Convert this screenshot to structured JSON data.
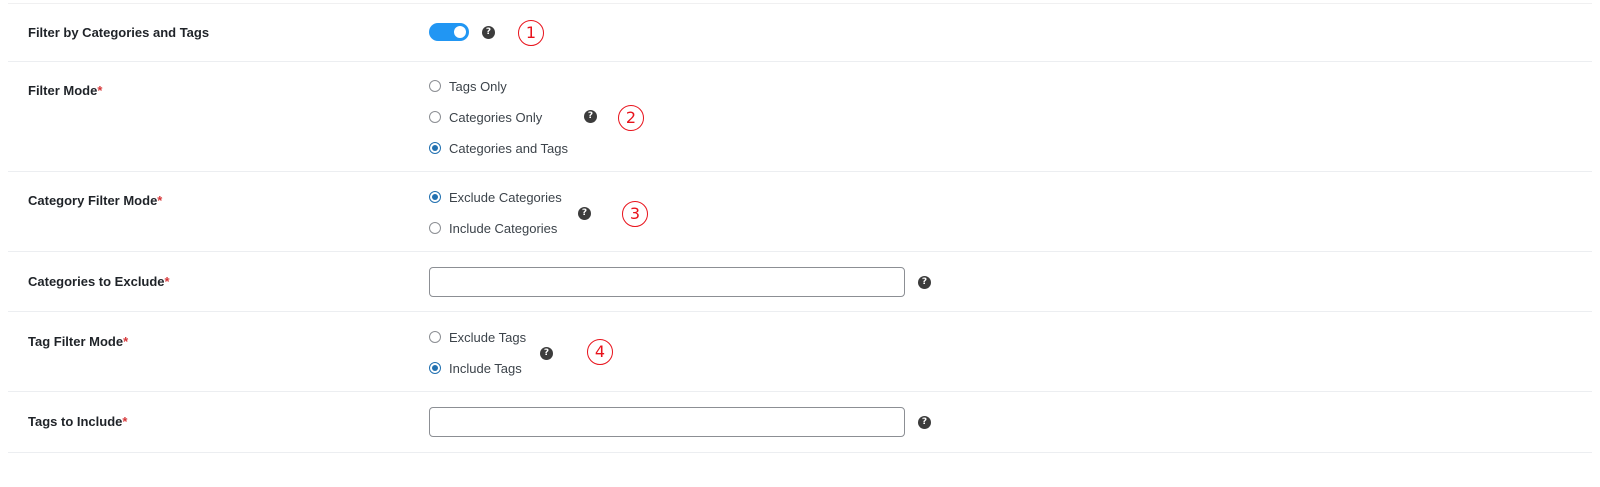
{
  "rows": {
    "filter_toggle": {
      "label": "Filter by Categories and Tags",
      "enabled": true,
      "help": "?",
      "marker": "1"
    },
    "filter_mode": {
      "label": "Filter Mode",
      "required": "*",
      "help": "?",
      "marker": "2",
      "options": [
        {
          "label": "Tags Only",
          "checked": false
        },
        {
          "label": "Categories Only",
          "checked": false
        },
        {
          "label": "Categories and Tags",
          "checked": true
        }
      ]
    },
    "category_filter_mode": {
      "label": "Category Filter Mode",
      "required": "*",
      "help": "?",
      "marker": "3",
      "options": [
        {
          "label": "Exclude Categories",
          "checked": true
        },
        {
          "label": "Include Categories",
          "checked": false
        }
      ]
    },
    "categories_to_exclude": {
      "label": "Categories to Exclude",
      "required": "*",
      "value": "",
      "placeholder": "",
      "help": "?"
    },
    "tag_filter_mode": {
      "label": "Tag Filter Mode",
      "required": "*",
      "help": "?",
      "marker": "4",
      "options": [
        {
          "label": "Exclude Tags",
          "checked": false
        },
        {
          "label": "Include Tags",
          "checked": true
        }
      ]
    },
    "tags_to_include": {
      "label": "Tags to Include",
      "required": "*",
      "value": "",
      "placeholder": "",
      "help": "?"
    }
  },
  "colors": {
    "accent": "#2196f3",
    "radio_checked": "#2271b1",
    "required": "#d63638",
    "marker": "#e8121b"
  }
}
